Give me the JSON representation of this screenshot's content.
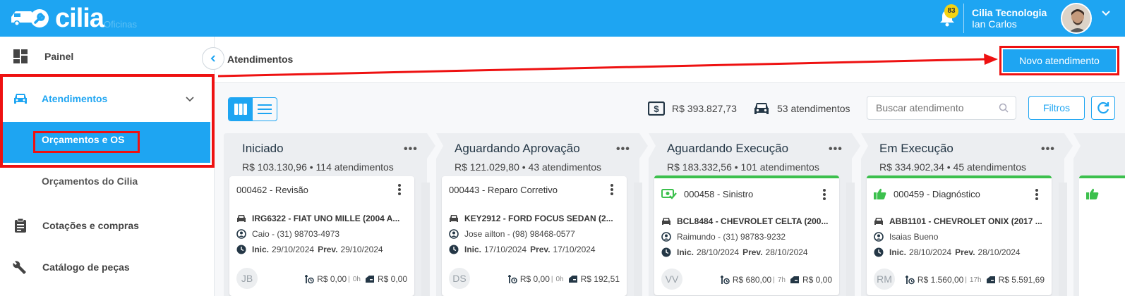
{
  "header": {
    "logo_text": "cilia",
    "logo_sub": "Oficinas",
    "notification_count": "83",
    "company": "Cilia Tecnologia",
    "user": "Ian Carlos"
  },
  "sidebar": {
    "items": [
      {
        "label": "Painel",
        "icon": "dashboard-icon"
      },
      {
        "label": "Atendimentos",
        "icon": "car-icon"
      },
      {
        "label": "Orçamentos e OS"
      },
      {
        "label": "Orçamentos do Cilia"
      },
      {
        "label": "Cotações e compras",
        "icon": "clipboard-icon"
      },
      {
        "label": "Catálogo de peças",
        "icon": "wrench-icon"
      }
    ]
  },
  "page": {
    "title": "Atendimentos",
    "new_button": "Novo atendimento"
  },
  "toolbar": {
    "total_value": "R$ 393.827,73",
    "total_count": "53 atendimentos",
    "search_placeholder": "Buscar atendimento",
    "filters_label": "Filtros"
  },
  "columns": [
    {
      "title": "Iniciado",
      "summary": "R$ 103.130,96 • 114 atendimentos",
      "card": {
        "title": "000462 - Revisão",
        "vehicle": "IRG6322 - FIAT UNO MILLE (2004 A...",
        "contact": "Caio  - (31) 98703-4973",
        "inic_label": "Inic.",
        "inic": "29/10/2024",
        "prev_label": "Prev.",
        "prev": "29/10/2024",
        "initials": "JB",
        "labor": "R$ 0,00",
        "hours": "0h",
        "parts": "R$ 0,00"
      }
    },
    {
      "title": "Aguardando Aprovação",
      "summary": "R$ 121.029,80 • 43 atendimentos",
      "card": {
        "title": "000443 - Reparo Corretivo",
        "vehicle": "KEY2912 - FORD FOCUS SEDAN (2...",
        "contact": "Jose ailton  - (98) 98468-0577",
        "inic_label": "Inic.",
        "inic": "17/10/2024",
        "prev_label": "Prev.",
        "prev": "17/10/2024",
        "initials": "DS",
        "labor": "R$ 0,00",
        "hours": "0h",
        "parts": "R$ 192,51"
      }
    },
    {
      "title": "Aguardando Execução",
      "summary": "R$ 183.332,56 • 101 atendimentos",
      "card": {
        "title": "000458 - Sinistro",
        "vehicle": "BCL8484 - CHEVROLET CELTA (200...",
        "contact": "Raimundo  - (31) 98783-9232",
        "inic_label": "Inic.",
        "inic": "28/10/2024",
        "prev_label": "Prev.",
        "prev": "28/10/2024",
        "initials": "VV",
        "labor": "R$ 680,00",
        "hours": "7h",
        "parts": "R$ 0,00"
      }
    },
    {
      "title": "Em Execução",
      "summary": "R$ 334.902,34 • 45 atendimentos",
      "card": {
        "title": "000459 - Diagnóstico",
        "vehicle": "ABB1101 - CHEVROLET ONIX (2017 ...",
        "contact": "Isaias Bueno",
        "inic_label": "Inic.",
        "inic": "28/10/2024",
        "prev_label": "Prev.",
        "prev": "28/10/2024",
        "initials": "RM",
        "labor": "R$ 1.560,00",
        "hours": "17h",
        "parts": "R$ 5.591,69"
      }
    }
  ],
  "colors": {
    "brand": "#1ea5f2",
    "highlight": "#ee1111",
    "approved_green": "#3cc04d",
    "notification": "#f5d311"
  }
}
